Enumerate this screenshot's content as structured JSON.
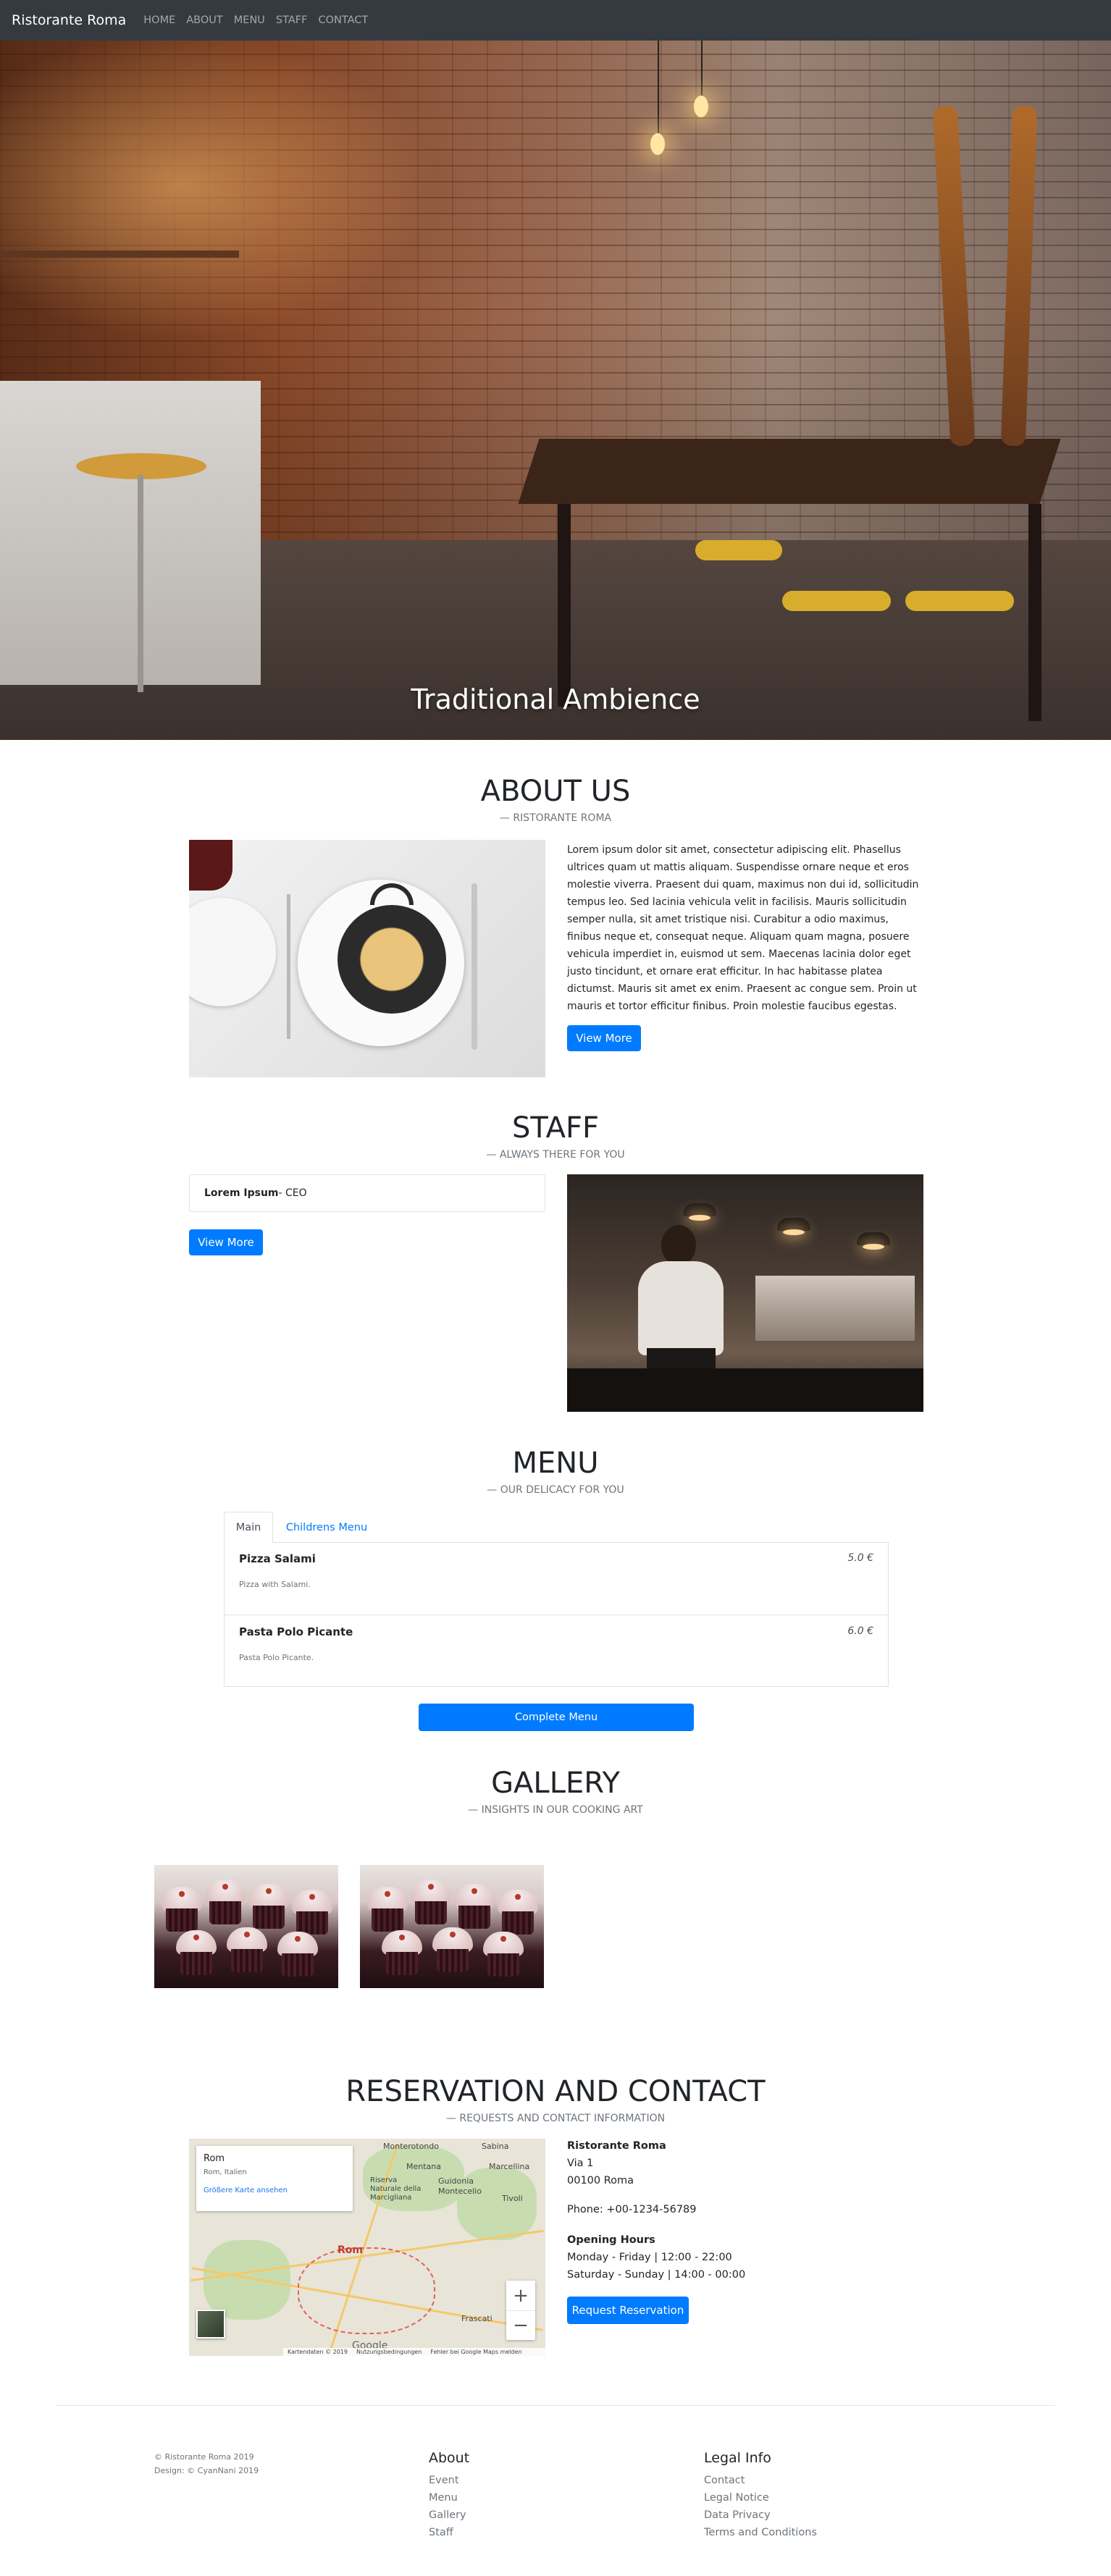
{
  "nav": {
    "brand": "Ristorante Roma",
    "links": [
      "HOME",
      "ABOUT",
      "MENU",
      "STAFF",
      "CONTACT"
    ]
  },
  "hero": {
    "caption": "Traditional Ambience"
  },
  "about": {
    "title": "ABOUT US",
    "subtitle": "— RISTORANTE ROMA",
    "text": "Lorem ipsum dolor sit amet, consectetur adipiscing elit. Phasellus ultrices quam ut mattis aliquam. Suspendisse ornare neque et eros molestie viverra. Praesent dui quam, maximus non dui id, sollicitudin tempus leo. Sed lacinia vehicula velit in facilisis. Mauris sollicitudin semper nulla, sit amet tristique nisi. Curabitur a odio maximus, finibus neque et, consequat neque. Aliquam quam magna, posuere vehicula imperdiet in, euismod ut sem. Maecenas lacinia dolor eget justo tincidunt, et ornare erat efficitur. In hac habitasse platea dictumst. Mauris sit amet ex enim. Praesent ac congue sem. Proin ut mauris et tortor efficitur finibus. Proin molestie faucibus egestas.",
    "button": "View More"
  },
  "staff": {
    "title": "STAFF",
    "subtitle": "— ALWAYS THERE FOR YOU",
    "member_name": "Lorem Ipsum",
    "member_role": " - CEO",
    "button": "View More"
  },
  "menu": {
    "title": "MENU",
    "subtitle": "— OUR DELICACY FOR YOU",
    "tabs": [
      "Main",
      "Childrens Menu"
    ],
    "items": [
      {
        "name": "Pizza Salami",
        "price": "5.0 €",
        "description": "Pizza with Salami."
      },
      {
        "name": "Pasta Polo Picante",
        "price": "6.0 €",
        "description": "Pasta Polo Picante."
      }
    ],
    "button": "Complete Menu"
  },
  "gallery": {
    "title": "GALLERY",
    "subtitle": "— INSIGHTS IN OUR COOKING ART"
  },
  "contact": {
    "title": "RESERVATION AND CONTACT",
    "subtitle": "— REQUESTS AND CONTACT INFORMATION",
    "name": "Ristorante Roma",
    "street": "Via 1",
    "city": "00100 Roma",
    "phone": "Phone: +00-1234-56789",
    "hours_title": "Opening Hours",
    "hours_weekday": "Monday - Friday | 12:00 - 22:00",
    "hours_weekend": "Saturday - Sunday | 14:00 - 00:00",
    "button": "Request Reservation"
  },
  "map": {
    "card_title": "Rom",
    "card_sub": "Rom, Italien",
    "card_link": "Größere Karte ansehen",
    "city_label": "Rom",
    "places": [
      "Monterotondo",
      "Sabina",
      "Mentana",
      "Marcellina",
      "Riserva Naturale della Marcigliana",
      "Guidonia Montecelio",
      "Tivoli",
      "Frascati"
    ],
    "zoom_in": "+",
    "zoom_out": "−",
    "google": "Google",
    "footer": [
      "Kartendaten © 2019",
      "Nutzungsbedingungen",
      "Fehler bei Google Maps melden"
    ]
  },
  "footer": {
    "copyright": "© Ristorante Roma 2019",
    "design": "Design: © CyanNani 2019",
    "about_title": "About",
    "about_links": [
      "Event",
      "Menu",
      "Gallery",
      "Staff"
    ],
    "legal_title": "Legal Info",
    "legal_links": [
      "Contact",
      "Legal Notice",
      "Data Privacy",
      "Terms and Conditions"
    ]
  }
}
